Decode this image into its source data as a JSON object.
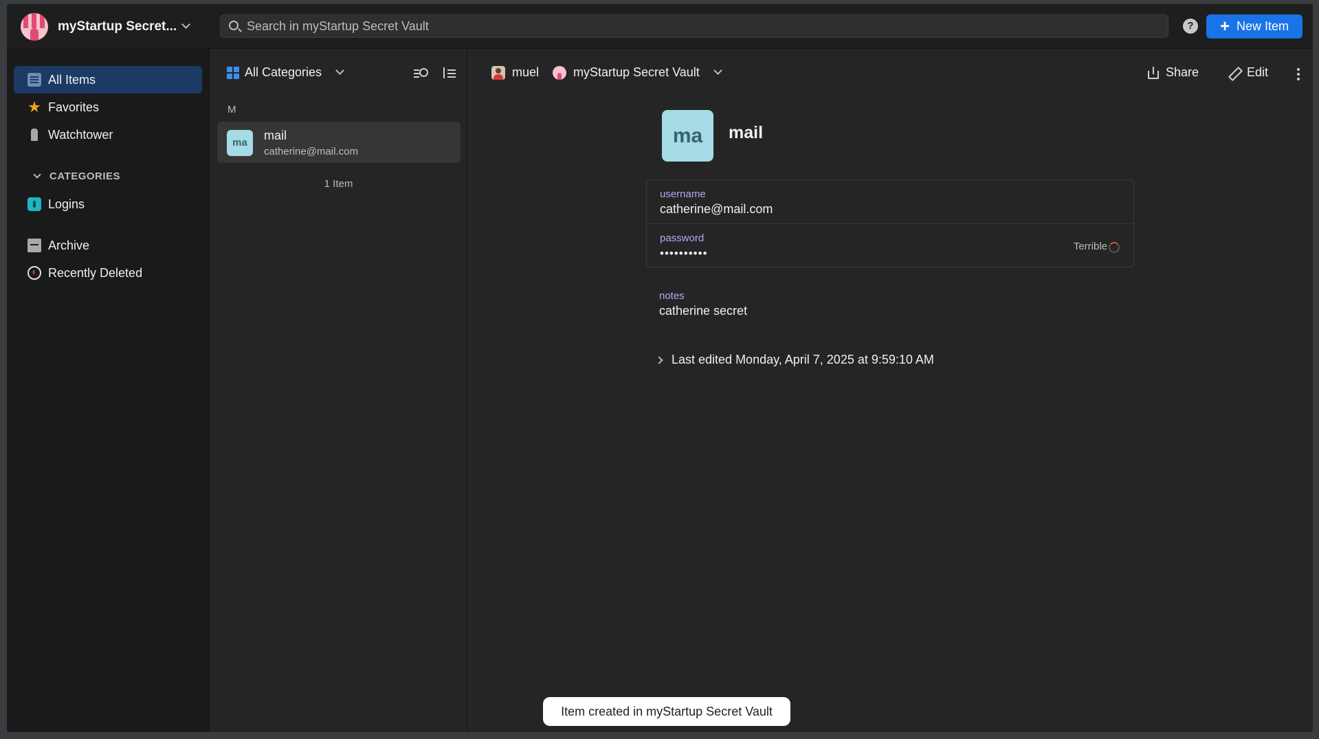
{
  "header": {
    "vault_name": "myStartup Secret...",
    "search_placeholder": "Search in myStartup Secret Vault",
    "help": "?",
    "new_item_label": "New Item"
  },
  "sidebar": {
    "items": [
      {
        "label": "All Items",
        "icon": "all-items-icon",
        "active": true
      },
      {
        "label": "Favorites",
        "icon": "star-icon"
      },
      {
        "label": "Watchtower",
        "icon": "watchtower-icon"
      }
    ],
    "categories_header": "CATEGORIES",
    "categories": [
      {
        "label": "Logins",
        "icon": "login-icon"
      }
    ],
    "bottom": [
      {
        "label": "Archive",
        "icon": "archive-icon"
      },
      {
        "label": "Recently Deleted",
        "icon": "recently-deleted-icon"
      }
    ]
  },
  "list": {
    "category_filter": "All Categories",
    "group_letter": "M",
    "rows": [
      {
        "avatar": "ma",
        "title": "mail",
        "subtitle": "catherine@mail.com"
      }
    ],
    "count": "1 Item"
  },
  "detail": {
    "owner": "muel",
    "vault": "myStartup Secret Vault",
    "share_label": "Share",
    "edit_label": "Edit",
    "avatar": "ma",
    "title": "mail",
    "fields": [
      {
        "label": "username",
        "value": "catherine@mail.com"
      },
      {
        "label": "password",
        "value": "••••••••••",
        "strength": "Terrible"
      }
    ],
    "notes_label": "notes",
    "notes_value": "catherine secret",
    "last_edited": "Last edited Monday, April 7, 2025 at 9:59:10 AM"
  },
  "toast": "Item created in myStartup Secret Vault",
  "colors": {
    "accent": "#1a73e8",
    "active_nav": "#1b3a64",
    "field_label": "#b9a5f3",
    "item_avatar": "#a5dbe5"
  }
}
